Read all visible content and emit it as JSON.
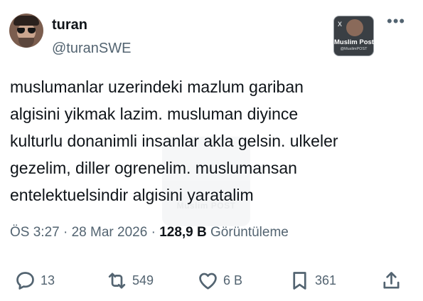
{
  "author": {
    "name": "turan",
    "handle": "@turanSWE",
    "avatar_icon": "profile-photo"
  },
  "badge": {
    "title": "Muslim Post",
    "subtitle": "@MuslimPOST",
    "mark": "X"
  },
  "watermark": "Muslim POST",
  "more_icon": "more-horizontal-icon",
  "tweet": {
    "text": "muslumanlar uzerindeki mazlum gariban\nalgisini yikmak lazim. musluman diyince\nkulturlu donanimli insanlar akla gelsin. ulkeler\ngezelim, diller ogrenelim. muslumansan\nentelektuelsindir algisini yaratalim"
  },
  "meta": {
    "time": "ÖS 3:27",
    "date": "28 Mar 2026",
    "separator": "·",
    "views_count": "128,9 B",
    "views_label": "Görüntüleme"
  },
  "actions": {
    "replies": "13",
    "reposts": "549",
    "likes": "6 B",
    "bookmarks": "361"
  },
  "colors": {
    "text": "#0f1419",
    "secondary": "#536471",
    "background": "#ffffff"
  }
}
